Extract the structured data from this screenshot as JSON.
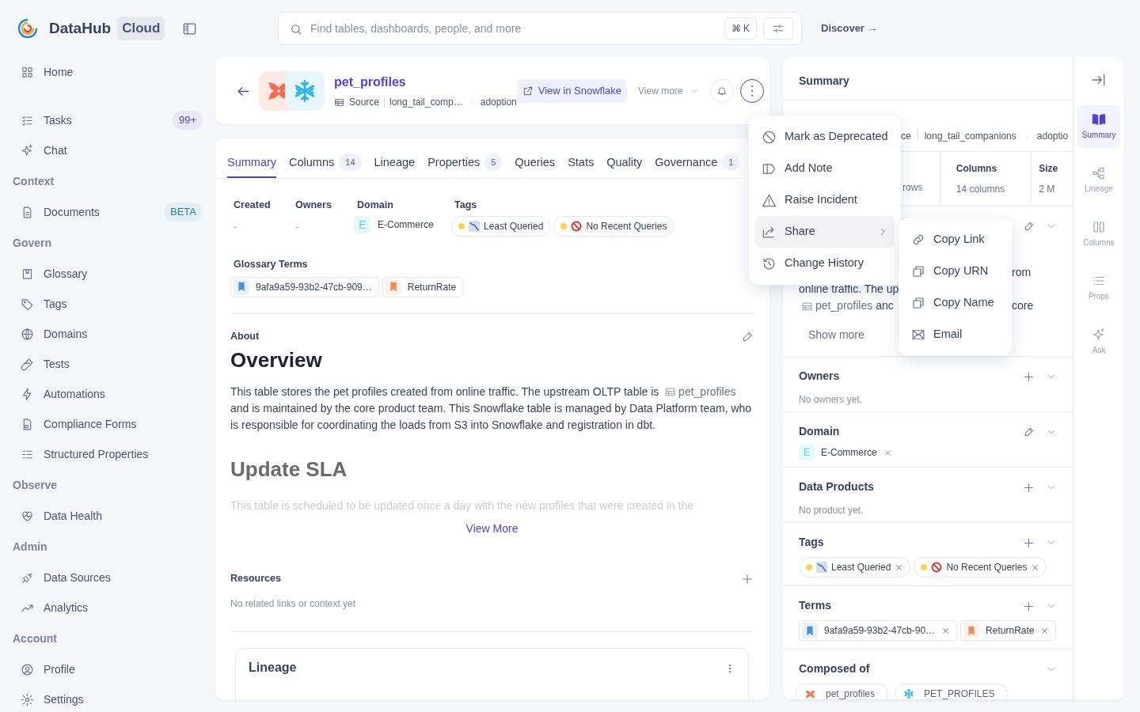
{
  "app": {
    "name": "DataHub",
    "edition": "Cloud"
  },
  "search": {
    "placeholder": "Find tables, dashboards, people, and more",
    "shortcut": "⌘ K"
  },
  "discover": "Discover →",
  "sidebar": [
    {
      "kind": "item",
      "label": "Home"
    },
    {
      "kind": "gap"
    },
    {
      "kind": "item",
      "label": "Tasks",
      "badge": {
        "text": "99+",
        "color": "#533fd1"
      }
    },
    {
      "kind": "item",
      "label": "Chat"
    },
    {
      "kind": "section",
      "label": "Context"
    },
    {
      "kind": "item",
      "label": "Documents",
      "badge": {
        "text": "BETA",
        "color": "#1f8a9e"
      }
    },
    {
      "kind": "section",
      "label": "Govern"
    },
    {
      "kind": "item",
      "label": "Glossary"
    },
    {
      "kind": "item",
      "label": "Tags"
    },
    {
      "kind": "item",
      "label": "Domains"
    },
    {
      "kind": "item",
      "label": "Tests"
    },
    {
      "kind": "item",
      "label": "Automations"
    },
    {
      "kind": "item",
      "label": "Compliance Forms"
    },
    {
      "kind": "item",
      "label": "Structured Properties"
    },
    {
      "kind": "section",
      "label": "Observe"
    },
    {
      "kind": "item",
      "label": "Data Health"
    },
    {
      "kind": "section",
      "label": "Admin"
    },
    {
      "kind": "item",
      "label": "Data Sources"
    },
    {
      "kind": "item",
      "label": "Analytics"
    },
    {
      "kind": "section",
      "label": "Account"
    },
    {
      "kind": "item",
      "label": "Profile"
    },
    {
      "kind": "item",
      "label": "Settings"
    }
  ],
  "entity": {
    "name": "pet_profiles",
    "type": "Source",
    "path": [
      "long_tail_comp…",
      "adoption"
    ],
    "view_button": "View in Snowflake",
    "view_more": "View more"
  },
  "tabs": [
    {
      "label": "Summary",
      "selected": true
    },
    {
      "label": "Columns",
      "count": "14",
      "selected": false
    },
    {
      "label": "Lineage",
      "selected": false
    },
    {
      "label": "Properties",
      "count": "5",
      "selected": false
    },
    {
      "label": "Queries",
      "selected": false
    },
    {
      "label": "Stats",
      "selected": false
    },
    {
      "label": "Quality",
      "selected": false
    },
    {
      "label": "Governance",
      "count": "1",
      "selected": false
    }
  ],
  "overview": {
    "fields": [
      {
        "label": "Created",
        "value": "-"
      },
      {
        "label": "Owners",
        "value": "-"
      }
    ],
    "domain": {
      "label": "Domain",
      "letter": "E",
      "name": "E-Commerce"
    },
    "tags": {
      "label": "Tags",
      "items": [
        {
          "label": "Least Queried"
        },
        {
          "label": "No Recent Queries"
        }
      ]
    },
    "glossary": {
      "label": "Glossary Terms",
      "items": [
        {
          "label": "9afa9a59-93b2-47cb-909…",
          "color": "#4c8ee6"
        },
        {
          "label": "ReturnRate",
          "color": "#f08a5d"
        }
      ]
    }
  },
  "about": {
    "label": "About",
    "heading": "Overview",
    "before": "This table stores the pet profiles created from online traffic. The upstream OLTP table is",
    "link": "pet_profiles",
    "after": "and is maintained by the core product team. This Snowflake table is managed by Data Platform team, who is responsible for coordinating the loads from S3 into Snowflake and registration in dbt.",
    "heading2": "Update SLA",
    "faded": "This table is scheduled to be updated once a day with the new profiles that were created in the",
    "view_more": "View More"
  },
  "resources": {
    "label": "Resources",
    "empty": "No related links or context yet"
  },
  "lineage": {
    "title": "Lineage"
  },
  "side_panel": {
    "title": "Summary",
    "path": [
      "ce",
      "long_tail_companions",
      "adoptio"
    ],
    "stats": [
      {
        "value": "rows"
      },
      {
        "label": "Columns",
        "value": "14 columns"
      },
      {
        "label": "Size",
        "value": "2 M"
      }
    ],
    "about_lines": [
      {
        "right": "rom"
      },
      {
        "left": "online traffic. The up"
      },
      {
        "link": "pet_profiles",
        "left": "anc",
        "right": "core"
      }
    ],
    "show_more": "Show more",
    "sections": [
      {
        "title": "Owners",
        "can_add": true,
        "empty": "No owners yet."
      },
      {
        "title": "Domain",
        "can_edit": true,
        "domain": {
          "letter": "E",
          "name": "E-Commerce"
        }
      },
      {
        "title": "Data Products",
        "can_add": true,
        "empty": "No product yet."
      },
      {
        "title": "Tags",
        "can_add": true,
        "tags": [
          {
            "label": "Least Queried"
          },
          {
            "label": "No Recent Queries"
          }
        ]
      },
      {
        "title": "Terms",
        "can_add": true,
        "terms": [
          {
            "label": "9afa9a59-93b2-47cb-90…",
            "color": "#4c8ee6"
          },
          {
            "label": "ReturnRate",
            "color": "#f08a5d"
          }
        ]
      },
      {
        "title": "Composed of",
        "assets": [
          {
            "name": "pet_profiles"
          },
          {
            "name": "PET_PROFILES"
          }
        ]
      }
    ]
  },
  "rail": [
    {
      "label": "Summary",
      "selected": true
    },
    {
      "label": "Lineage",
      "selected": false
    },
    {
      "label": "Columns",
      "selected": false
    },
    {
      "label": "Props",
      "selected": false
    },
    {
      "label": "Ask",
      "selected": false
    }
  ],
  "menu": [
    {
      "label": "Mark as Deprecated",
      "highlighted": false
    },
    {
      "label": "Add Note",
      "highlighted": false
    },
    {
      "label": "Raise Incident",
      "highlighted": false
    },
    {
      "label": "Share",
      "highlighted": true,
      "submenu": true
    },
    {
      "label": "Change History",
      "highlighted": false
    }
  ],
  "submenu": [
    {
      "label": "Copy Link"
    },
    {
      "label": "Copy URN"
    },
    {
      "label": "Copy Name"
    },
    {
      "label": "Email"
    }
  ]
}
